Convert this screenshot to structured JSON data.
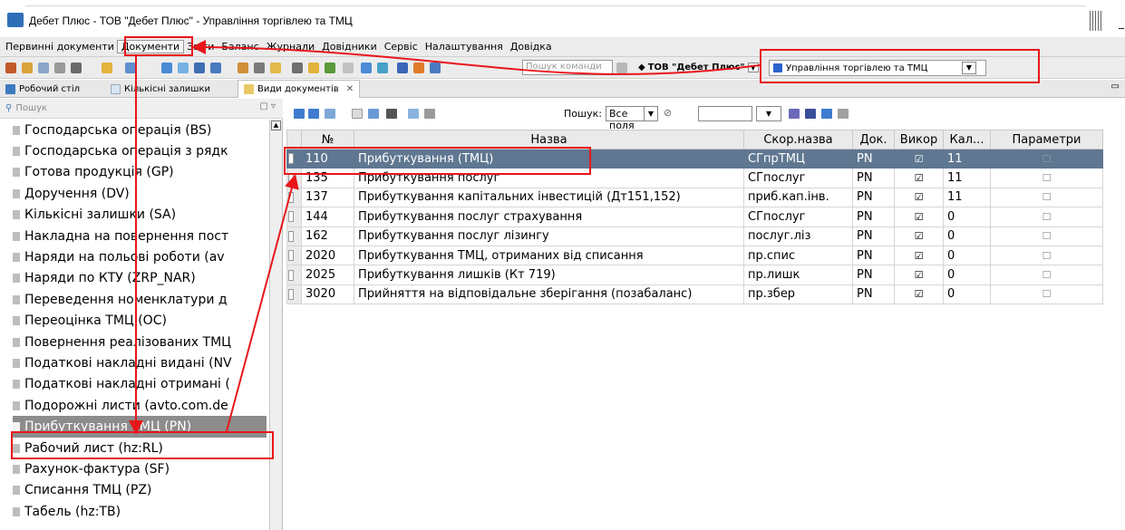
{
  "window": {
    "title": "Дебет Плюс - ТОВ \"Дебет Плюс\" - Управління торгівлею та ТМЦ",
    "minimize_label": "_"
  },
  "menu": {
    "items": [
      "Первинні документи",
      "Документи",
      "Звіти",
      "Баланс",
      "Журнали",
      "Довідники",
      "Сервіс",
      "Налаштування",
      "Довідка"
    ],
    "active_index": 1
  },
  "toolbar": {
    "command_search_placeholder": "Пошук команди",
    "company": "ТОВ \"Дебет Плюс\"",
    "module": "Управління торгівлею та ТМЦ"
  },
  "tabs": [
    {
      "label": "Робочий стіл",
      "active": false
    },
    {
      "label": "Кількісні залишки",
      "active": false
    },
    {
      "label": "Види документів",
      "active": true
    }
  ],
  "left_panel": {
    "search_placeholder": "Пошук",
    "items": [
      "Господарська операція (BS)",
      "Господарська операція з рядк",
      "Готова продукція (GP)",
      "Доручення (DV)",
      "Кількісні залишки (SA)",
      "Накладна на повернення пост",
      "Наряди на польові роботи (av",
      "Наряди по КТУ (ZRP_NAR)",
      "Переведення номенклатури д",
      "Переоцінка ТМЦ (OC)",
      "Повернення реалізованих ТМЦ",
      "Податкові накладні видані (NV",
      "Податкові накладні отримані (",
      "Подорожні листи (avto.com.de",
      "Прибуткування ТМЦ (PN)",
      "Рабочий лист (hz:RL)",
      "Рахунок-фактура (SF)",
      "Списання ТМЦ (PZ)",
      "Табель (hz:TB)"
    ],
    "selected_index": 14
  },
  "grid_toolbar": {
    "search_label": "Пошук:",
    "search_field": "Все поля"
  },
  "grid": {
    "columns": [
      "№",
      "Назва",
      "Скор.назва",
      "Док.",
      "Викор",
      "Кал...",
      "Параметри"
    ],
    "rows": [
      {
        "no": "110",
        "name": "Прибуткування (ТМЦ)",
        "short": "СГпрТМЦ",
        "doc": "PN",
        "used": "☑",
        "cal": "11",
        "params": "☐"
      },
      {
        "no": "135",
        "name": "Прибуткування послуг",
        "short": "СГпослуг",
        "doc": "PN",
        "used": "☑",
        "cal": "11",
        "params": "☐"
      },
      {
        "no": "137",
        "name": "Прибуткування капітальних інвестицій (Дт151,152)",
        "short": "приб.кап.інв.",
        "doc": "PN",
        "used": "☑",
        "cal": "11",
        "params": "☐"
      },
      {
        "no": "144",
        "name": "Прибуткування послуг страхування",
        "short": "СГпослуг",
        "doc": "PN",
        "used": "☑",
        "cal": "0",
        "params": "☐"
      },
      {
        "no": "162",
        "name": "Прибуткування послуг лізингу",
        "short": "послуг.ліз",
        "doc": "PN",
        "used": "☑",
        "cal": "0",
        "params": "☐"
      },
      {
        "no": "2020",
        "name": "Прибуткування ТМЦ, отриманих від списання",
        "short": "пр.спис",
        "doc": "PN",
        "used": "☑",
        "cal": "0",
        "params": "☐"
      },
      {
        "no": "2025",
        "name": "Прибуткування лишків (Кт 719)",
        "short": "пр.лишк",
        "doc": "PN",
        "used": "☑",
        "cal": "0",
        "params": "☐"
      },
      {
        "no": "3020",
        "name": "Прийняття на відповідальне зберігання (позабаланс)",
        "short": "пр.збер",
        "doc": "PN",
        "used": "☑",
        "cal": "0",
        "params": "☐"
      }
    ],
    "selected_index": 0
  },
  "colors": {
    "annotation": "#e8161b",
    "grid_selection": "#5f7790",
    "list_selection": "#8c8c8c"
  }
}
